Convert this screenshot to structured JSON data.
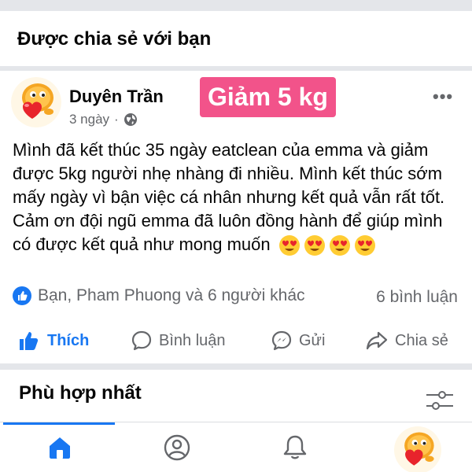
{
  "section": {
    "title": "Được chia sẻ với bạn"
  },
  "post": {
    "author": "Duyên Trần",
    "time": "3 ngày",
    "separator": "·",
    "tag": "Giảm 5 kg",
    "more": "•••",
    "body": "Mình đã kết thúc 35 ngày eatclean của emma và giảm được 5kg người nhẹ nhàng đi nhiều. Mình kết thúc sớm mấy ngày vì bận việc cá nhân nhưng kết quả vẫn rất tốt. Cảm ơn đội ngũ emma đã luôn đồng hành để giúp mình có được kết quả như mong muốn",
    "reactions_text": "Bạn, Pham Phuong và 6 người khác",
    "comment_count": "6 bình luận"
  },
  "actions": {
    "like": "Thích",
    "comment": "Bình luận",
    "send": "Gửi",
    "share": "Chia sẻ"
  },
  "relevant": {
    "title": "Phù hợp nhất"
  },
  "icons": {
    "globe": "globe-icon",
    "like_badge": "like-badge-icon",
    "filter": "filter-icon",
    "home": "home-icon",
    "profile": "profile-icon",
    "notifications": "bell-icon"
  },
  "colors": {
    "accent": "#1877f2",
    "tag_bg": "#f2538a",
    "muted": "#65676b",
    "divider": "#e4e6ea"
  }
}
